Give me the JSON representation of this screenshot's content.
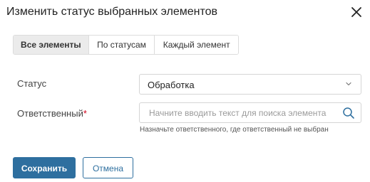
{
  "dialog": {
    "title": "Изменить статус выбранных элементов"
  },
  "tabs": [
    {
      "label": "Все элементы",
      "active": true
    },
    {
      "label": "По статусам",
      "active": false
    },
    {
      "label": "Каждый элемент",
      "active": false
    }
  ],
  "form": {
    "status": {
      "label": "Статус",
      "value": "Обработка"
    },
    "responsible": {
      "label": "Ответственный",
      "required_mark": "*",
      "value": "",
      "placeholder": "Начните вводить текст для поиска элемента",
      "hint": "Назначьте ответственного, где ответственный не выбран"
    }
  },
  "actions": {
    "save_label": "Сохранить",
    "cancel_label": "Отмена"
  },
  "colors": {
    "primary": "#2e6f9f",
    "required": "#d0021b"
  },
  "icons": {
    "close": "close-icon",
    "chevron": "chevron-down-icon",
    "search": "search-icon"
  }
}
